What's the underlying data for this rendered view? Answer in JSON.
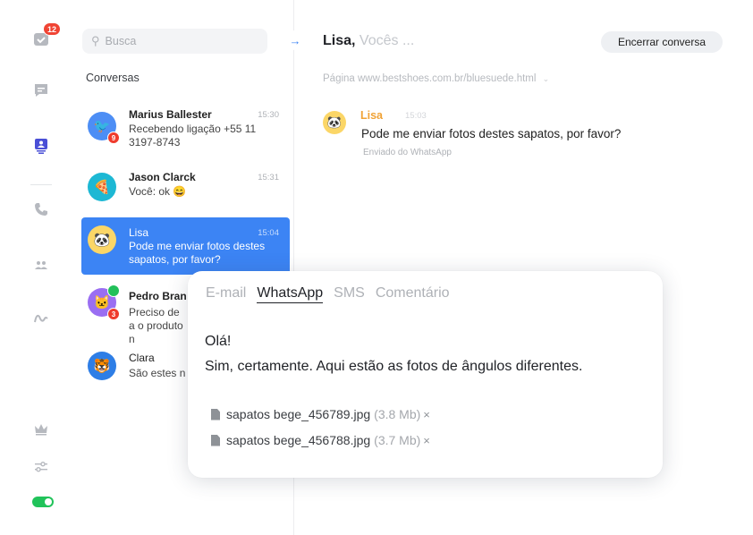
{
  "rail": {
    "inbox_badge": "12",
    "colors": {
      "active": "#4a4fd6",
      "inactive": "#b6b9bf",
      "badge": "#f04434",
      "toggle": "#21c35a"
    }
  },
  "conversations": {
    "search_placeholder": "Busca",
    "heading": "Conversas",
    "items": [
      {
        "name": "Marius Ballester",
        "time": "15:30",
        "preview": "Recebendo ligação +55 11 3197-8743",
        "badge": "9"
      },
      {
        "name": "Jason Clarck",
        "time": "15:31",
        "preview": "Você: ok 😄"
      },
      {
        "name": "Lisa",
        "time": "15:04",
        "preview": "Pode me enviar fotos destes sapatos, por favor?"
      },
      {
        "name": "Pedro Bran",
        "time": "",
        "preview": "Preciso de a o produto n",
        "badge": "3"
      },
      {
        "name": "Clara",
        "time": "",
        "preview": "São estes n"
      }
    ]
  },
  "chat": {
    "title_name": "Lisa,",
    "title_sub": "Vocês ...",
    "end_button": "Encerrar conversa",
    "page_link": "Página www.bestshoes.com.br/bluesuede.html",
    "message": {
      "author": "Lisa",
      "time": "15:03",
      "text": "Pode me enviar fotos destes sapatos, por favor?",
      "via": "Enviado do WhatsApp"
    }
  },
  "composer": {
    "tabs": [
      "E-mail",
      "WhatsApp",
      "SMS",
      "Comentário"
    ],
    "active_tab": "WhatsApp",
    "lines": [
      "Olá!",
      "Sim, certamente. Aqui estão as fotos de ângulos diferentes."
    ],
    "attachments": [
      {
        "name": "sapatos bege_456789.jpg",
        "size": "(3.8 Mb)",
        "remove": "×"
      },
      {
        "name": "sapatos bege_456788.jpg",
        "size": "(3.7 Mb)",
        "remove": "×"
      }
    ]
  },
  "accent_color": "#3c84f4"
}
